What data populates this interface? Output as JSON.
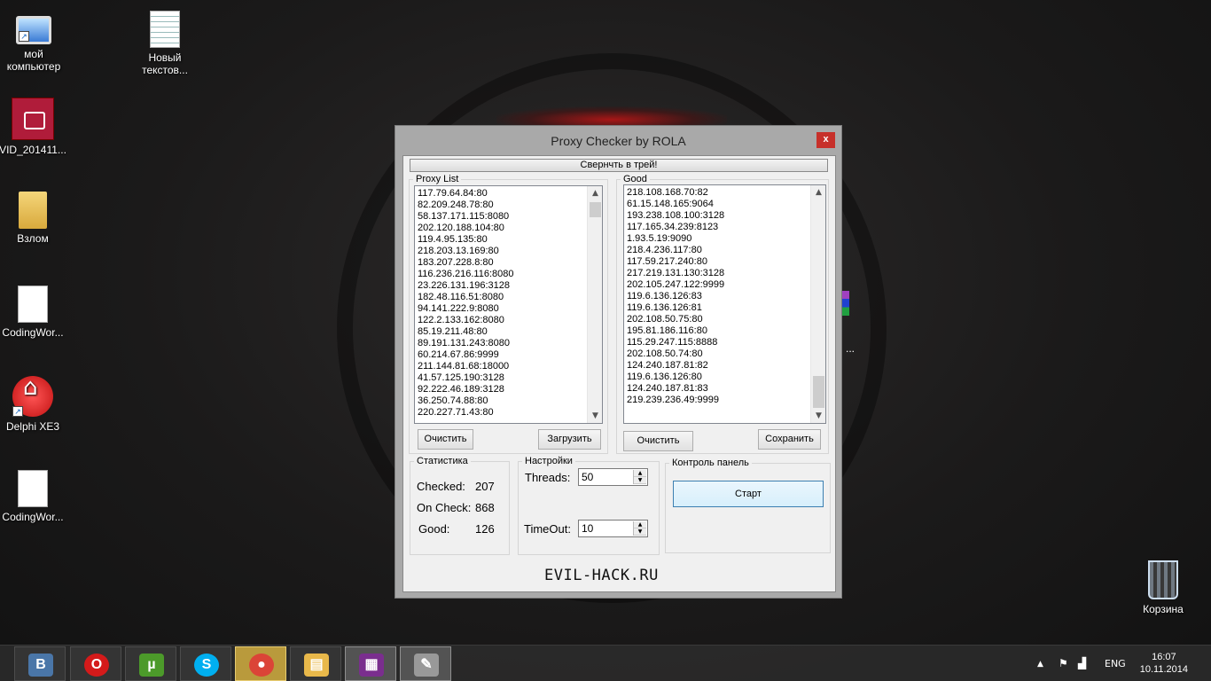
{
  "desktop": {
    "icons": [
      {
        "label": "мой\nкомпьютер",
        "line1": "мой",
        "line2": "компьютер"
      },
      {
        "line1": "Новый",
        "line2": "текстов..."
      },
      {
        "line1": "VID_201411..."
      },
      {
        "line1": "Взлом"
      },
      {
        "line1": "CodingWor..."
      },
      {
        "line1": "Delphi XE3"
      },
      {
        "line1": "CodingWor..."
      },
      {
        "line1": "Корзина"
      }
    ],
    "stray_label": "..."
  },
  "window": {
    "title": "Proxy Checker by ROLA",
    "close_label": "x",
    "tray_button_label": "Свернчть в трей!",
    "proxy_list": {
      "label": "Proxy List",
      "items": [
        "117.79.64.84:80",
        "82.209.248.78:80",
        "58.137.171.115:8080",
        "202.120.188.104:80",
        "119.4.95.135:80",
        "218.203.13.169:80",
        "183.207.228.8:80",
        "116.236.216.116:8080",
        "23.226.131.196:3128",
        "182.48.116.51:8080",
        "94.141.222.9:8080",
        "122.2.133.162:8080",
        "85.19.211.48:80",
        "89.191.131.243:8080",
        "60.214.67.86:9999",
        "211.144.81.68:18000",
        "41.57.125.190:3128",
        "92.222.46.189:3128",
        "36.250.74.88:80",
        "220.227.71.43:80"
      ],
      "clear_label": "Очистить",
      "load_label": "Загрузить"
    },
    "good_list": {
      "label": "Good",
      "items": [
        "218.108.168.70:82",
        "61.15.148.165:9064",
        "193.238.108.100:3128",
        "117.165.34.239:8123",
        "1.93.5.19:9090",
        "218.4.236.117:80",
        "117.59.217.240:80",
        "217.219.131.130:3128",
        "202.105.247.122:9999",
        "119.6.136.126:83",
        "119.6.136.126:81",
        "202.108.50.75:80",
        "195.81.186.116:80",
        "115.29.247.115:8888",
        "202.108.50.74:80",
        "124.240.187.81:82",
        "119.6.136.126:80",
        "124.240.187.81:83",
        "219.239.236.49:9999"
      ],
      "clear_label": "Очистить",
      "save_label": "Сохранить"
    },
    "stats": {
      "label": "Статистика",
      "checked_label": "Checked:",
      "checked_value": "207",
      "oncheck_label": "On Check:",
      "oncheck_value": "868",
      "good_label": "Good:",
      "good_value": "126"
    },
    "settings": {
      "label": "Настройки",
      "threads_label": "Threads:",
      "threads_value": "50",
      "timeout_label": "TimeOut:",
      "timeout_value": "10"
    },
    "control": {
      "label": "Контроль панель",
      "start_label": "Старт"
    },
    "footer_text": "EVIL-HACK.RU"
  },
  "taskbar": {
    "buttons": [
      {
        "name": "vk",
        "glyph": "B",
        "color": "#4a76a8"
      },
      {
        "name": "opera",
        "glyph": "O",
        "color": "#d41a1a"
      },
      {
        "name": "utorrent",
        "glyph": "µ",
        "color": "#4c9a2a"
      },
      {
        "name": "skype",
        "glyph": "S",
        "color": "#00aff0"
      },
      {
        "name": "chrome",
        "glyph": "●",
        "color": "#db4437"
      },
      {
        "name": "explorer",
        "glyph": "▤",
        "color": "#e8b84a"
      },
      {
        "name": "winrar",
        "glyph": "▦",
        "color": "#7a2e8e"
      },
      {
        "name": "proxy-checker",
        "glyph": "✎",
        "color": "#999999"
      }
    ],
    "language": "ENG",
    "time": "16:07",
    "date": "10.11.2014"
  }
}
